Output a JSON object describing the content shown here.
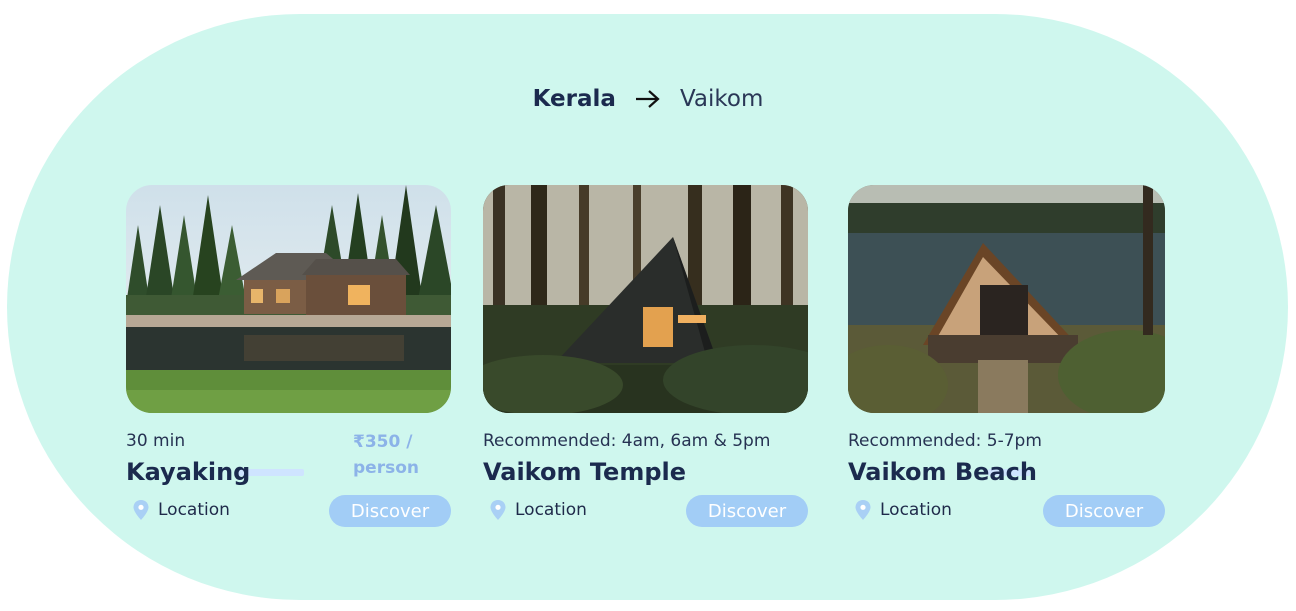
{
  "breadcrumb": {
    "from": "Kerala",
    "to": "Vaikom"
  },
  "cards": [
    {
      "meta": "30 min",
      "price": "₹350 / person",
      "title": "Kayaking",
      "location": "Location",
      "button": "Discover",
      "image": "lake-cabin-photo"
    },
    {
      "meta": "Recommended: 4am, 6am & 5pm",
      "title": "Vaikom Temple",
      "location": "Location",
      "button": "Discover",
      "image": "forest-a-frame-photo"
    },
    {
      "meta": "Recommended: 5-7pm",
      "title": "Vaikom Beach",
      "location": "Location",
      "button": "Discover",
      "image": "lakeside-a-frame-photo"
    }
  ],
  "colors": {
    "background": "#cff7ee",
    "accent_button": "#a2cdf6",
    "title": "#1b2a4e",
    "price": "#8cb3e8"
  }
}
